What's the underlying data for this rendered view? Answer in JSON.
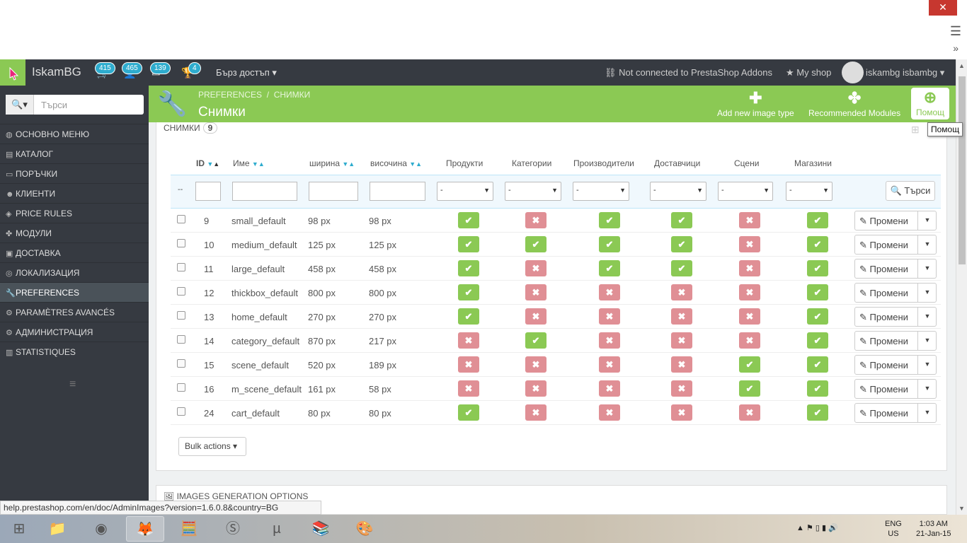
{
  "browser": {
    "close": "✕",
    "menu": "☰",
    "more": "»"
  },
  "header": {
    "shop_name": "IskamBG",
    "notifications": [
      {
        "icon": "cart-icon",
        "count": "415"
      },
      {
        "icon": "user-icon",
        "count": "465"
      },
      {
        "icon": "mail-icon",
        "count": "139"
      },
      {
        "icon": "trophy-icon",
        "count": "4"
      }
    ],
    "quick_access": "Бърз достъп",
    "addons": "Not connected to PrestaShop Addons",
    "my_shop": "My shop",
    "user": "iskambg isbambg"
  },
  "sidebar": {
    "search_placeholder": "Търси",
    "items": [
      {
        "label": "ОСНОВНО МЕНЮ",
        "icon": "dashboard-icon"
      },
      {
        "label": "КАТАЛОГ",
        "icon": "book-icon"
      },
      {
        "label": "ПОРЪЧКИ",
        "icon": "credit-card-icon"
      },
      {
        "label": "КЛИЕНТИ",
        "icon": "users-icon"
      },
      {
        "label": "PRICE RULES",
        "icon": "tag-icon"
      },
      {
        "label": "МОДУЛИ",
        "icon": "puzzle-icon"
      },
      {
        "label": "ДОСТАВКА",
        "icon": "truck-icon"
      },
      {
        "label": "ЛОКАЛИЗАЦИЯ",
        "icon": "globe-icon"
      },
      {
        "label": "PREFERENCES",
        "icon": "wrench-icon"
      },
      {
        "label": "PARAMÈTRES AVANCÉS",
        "icon": "cogs-icon"
      },
      {
        "label": "АДМИНИСТРАЦИЯ",
        "icon": "gear-icon"
      },
      {
        "label": "STATISTIQUES",
        "icon": "bar-chart-icon"
      }
    ]
  },
  "toolbar": {
    "breadcrumb_1": "PREFERENCES",
    "breadcrumb_sep": "/",
    "breadcrumb_2": "СНИМКИ",
    "title": "Снимки",
    "add_label": "Add new image type",
    "modules_label": "Recommended Modules",
    "help_label": "Помощ",
    "tooltip": "Помощ"
  },
  "panel": {
    "title": "СНИМКИ",
    "count": "9",
    "columns": [
      "ID",
      "Име",
      "ширина",
      "височина",
      "Продукти",
      "Категории",
      "Производители",
      "Доставчици",
      "Сцени",
      "Магазини"
    ],
    "filter_dash": "--",
    "select_value": "-",
    "filter_button": "Търси",
    "edit_label": "Промени",
    "bulk": "Bulk actions",
    "rows": [
      {
        "id": "9",
        "name": "small_default",
        "w": "98 px",
        "h": "98 px",
        "flags": [
          1,
          0,
          1,
          1,
          0,
          1
        ]
      },
      {
        "id": "10",
        "name": "medium_default",
        "w": "125 px",
        "h": "125 px",
        "flags": [
          1,
          1,
          1,
          1,
          0,
          1
        ]
      },
      {
        "id": "11",
        "name": "large_default",
        "w": "458 px",
        "h": "458 px",
        "flags": [
          1,
          0,
          1,
          1,
          0,
          1
        ]
      },
      {
        "id": "12",
        "name": "thickbox_default",
        "w": "800 px",
        "h": "800 px",
        "flags": [
          1,
          0,
          0,
          0,
          0,
          1
        ]
      },
      {
        "id": "13",
        "name": "home_default",
        "w": "270 px",
        "h": "270 px",
        "flags": [
          1,
          0,
          0,
          0,
          0,
          1
        ]
      },
      {
        "id": "14",
        "name": "category_default",
        "w": "870 px",
        "h": "217 px",
        "flags": [
          0,
          1,
          0,
          0,
          0,
          1
        ]
      },
      {
        "id": "15",
        "name": "scene_default",
        "w": "520 px",
        "h": "189 px",
        "flags": [
          0,
          0,
          0,
          0,
          1,
          1
        ]
      },
      {
        "id": "16",
        "name": "m_scene_default",
        "w": "161 px",
        "h": "58 px",
        "flags": [
          0,
          0,
          0,
          0,
          1,
          1
        ]
      },
      {
        "id": "24",
        "name": "cart_default",
        "w": "80 px",
        "h": "80 px",
        "flags": [
          1,
          0,
          0,
          0,
          0,
          1
        ]
      }
    ]
  },
  "panel2": {
    "title": "IMAGES GENERATION OPTIONS"
  },
  "status_url": "help.prestashop.com/en/doc/AdminImages?version=1.6.0.8&country=BG",
  "taskbar": {
    "apps": [
      "windows-start-icon",
      "file-explorer-icon",
      "chrome-icon",
      "firefox-icon",
      "calculator-icon",
      "skype-icon",
      "utorrent-icon",
      "winrar-icon",
      "paint-icon"
    ],
    "lang_1": "ENG",
    "lang_2": "US",
    "time": "1:03 AM",
    "date": "21-Jan-15"
  }
}
